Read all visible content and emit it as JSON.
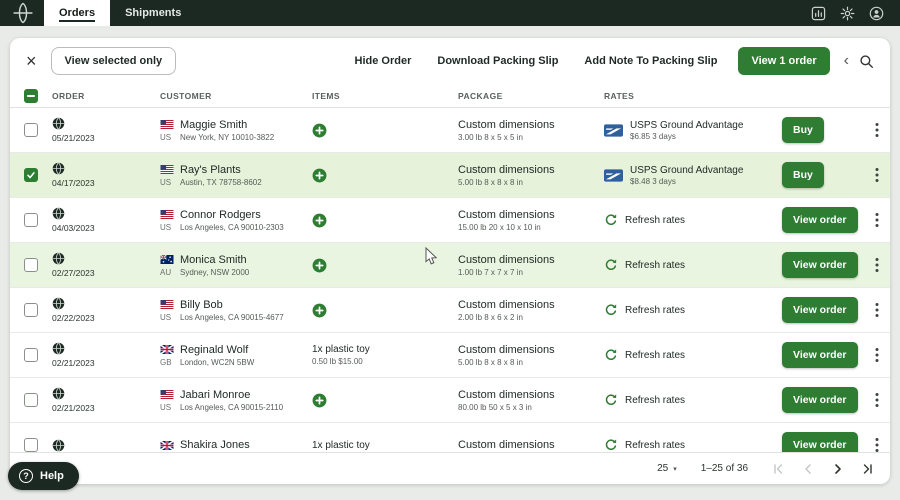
{
  "topbar": {
    "tabs": [
      {
        "label": "Orders"
      },
      {
        "label": "Shipments"
      }
    ]
  },
  "toolbar": {
    "view_selected_label": "View selected only",
    "hide_order_label": "Hide Order",
    "download_slip_label": "Download Packing Slip",
    "add_note_label": "Add Note To Packing Slip",
    "view_order_label": "View 1 order"
  },
  "table": {
    "headers": {
      "order": "ORDER",
      "customer": "CUSTOMER",
      "items": "ITEMS",
      "package": "PACKAGE",
      "rates": "RATES"
    },
    "rows": [
      {
        "date": "05/21/2023",
        "country_code": "US",
        "customer": "Maggie Smith",
        "address": "New York, NY 10010-3822",
        "package_title": "Custom dimensions",
        "package_detail": "3.00 lb 8 x 5 x 5 in",
        "rate_name": "USPS Ground Advantage",
        "rate_detail": "$6.85 3 days",
        "action_label": "Buy",
        "checked": false,
        "selected": false
      },
      {
        "date": "04/17/2023",
        "country_code": "US",
        "customer": "Ray's Plants",
        "address": "Austin, TX 78758-8602",
        "package_title": "Custom dimensions",
        "package_detail": "5.00 lb 8 x 8 x 8 in",
        "rate_name": "USPS Ground Advantage",
        "rate_detail": "$8.48 3 days",
        "action_label": "Buy",
        "checked": true,
        "selected": true
      },
      {
        "date": "04/03/2023",
        "country_code": "US",
        "customer": "Connor Rodgers",
        "address": "Los Angeles, CA 90010-2303",
        "package_title": "Custom dimensions",
        "package_detail": "15.00 lb 20 x 10 x 10 in",
        "rate_name": "Refresh rates",
        "action_label": "View order",
        "checked": false,
        "selected": false
      },
      {
        "date": "02/27/2023",
        "country_code": "AU",
        "customer": "Monica Smith",
        "address": "Sydney, NSW 2000",
        "package_title": "Custom dimensions",
        "package_detail": "1.00 lb 7 x 7 x 7 in",
        "rate_name": "Refresh rates",
        "action_label": "View order",
        "checked": false,
        "selected": false,
        "hovered": true
      },
      {
        "date": "02/22/2023",
        "country_code": "US",
        "customer": "Billy Bob",
        "address": "Los Angeles, CA 90015-4677",
        "package_title": "Custom dimensions",
        "package_detail": "2.00 lb 8 x 6 x 2 in",
        "rate_name": "Refresh rates",
        "action_label": "View order",
        "checked": false,
        "selected": false
      },
      {
        "date": "02/21/2023",
        "country_code": "GB",
        "customer": "Reginald Wolf",
        "address": "London, WC2N 5BW",
        "item_line1": "1x plastic toy",
        "item_line2": "0.50 lb  $15.00",
        "package_title": "Custom dimensions",
        "package_detail": "5.00 lb 8 x 8 x 8 in",
        "rate_name": "Refresh rates",
        "action_label": "View order",
        "checked": false,
        "selected": false
      },
      {
        "date": "02/21/2023",
        "country_code": "US",
        "customer": "Jabari Monroe",
        "address": "Los Angeles, CA 90015-2110",
        "package_title": "Custom dimensions",
        "package_detail": "80.00 lb 50 x 5 x 3 in",
        "rate_name": "Refresh rates",
        "action_label": "View order",
        "checked": false,
        "selected": false
      },
      {
        "country_code": "GB",
        "customer": "Shakira Jones",
        "item_line1": "1x plastic toy",
        "package_title": "Custom dimensions",
        "rate_name": "Refresh rates",
        "action_label": "View order",
        "checked": false,
        "selected": false
      }
    ]
  },
  "pagination": {
    "page_size": "25",
    "range_label": "1–25 of 36"
  },
  "help_label": "Help",
  "colors": {
    "accent_green": "#2e7d32",
    "topbar_dark": "#1c2922",
    "selected_row": "#e6f2da",
    "usps_blue": "#2e5f9e"
  }
}
